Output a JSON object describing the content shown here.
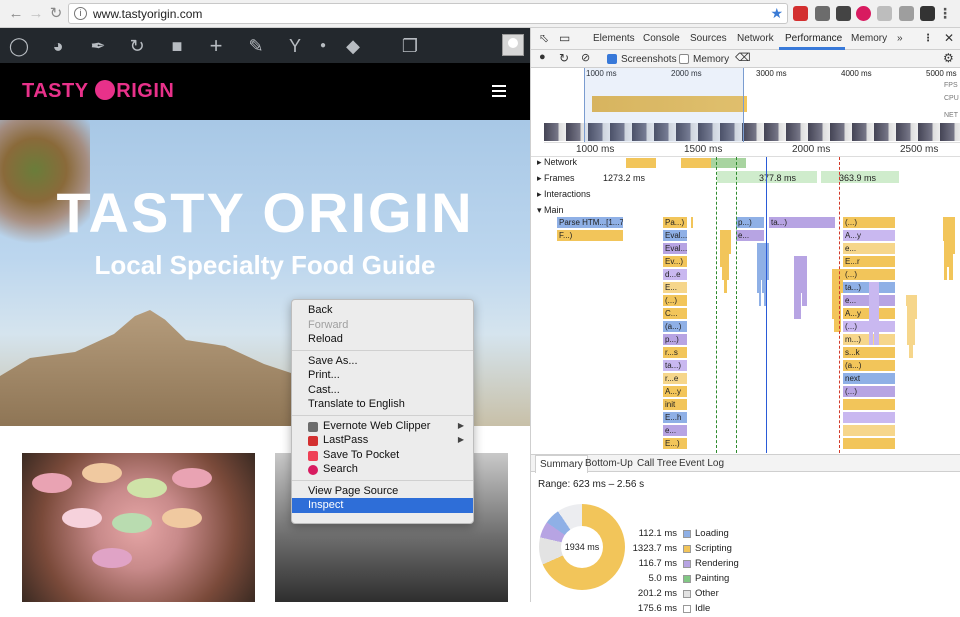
{
  "browser": {
    "url": "www.tastyorigin.com",
    "back_icon": "arrow-left",
    "forward_icon": "arrow-right",
    "reload_icon": "reload"
  },
  "wp_admin_bar": {
    "icons": [
      "wordpress-logo",
      "dashboard",
      "customize-brush",
      "updates",
      "comments",
      "new-plus",
      "edit-pencil",
      "yoast-seo",
      "dot",
      "layers"
    ]
  },
  "site": {
    "logo_part1": "TASTY",
    "logo_part2": "RIGIN",
    "hero_title": "TASTY ORIGIN",
    "hero_subtitle": "Local Specialty Food Guide",
    "accent_color": "#e8318a"
  },
  "context_menu": {
    "back": "Back",
    "forward": "Forward",
    "reload": "Reload",
    "save_as": "Save As...",
    "print": "Print...",
    "cast": "Cast...",
    "translate": "Translate to English",
    "evernote": "Evernote Web Clipper",
    "lastpass": "LastPass",
    "pocket": "Save To Pocket",
    "search": "Search",
    "view_source": "View Page Source",
    "inspect": "Inspect"
  },
  "devtools": {
    "tabs": [
      "Elements",
      "Console",
      "Sources",
      "Network",
      "Performance",
      "Memory",
      "»"
    ],
    "active_tab": "Performance",
    "screenshots_label": "Screenshots",
    "memory_label": "Memory",
    "overview_ticks": [
      "1000 ms",
      "2000 ms",
      "3000 ms",
      "4000 ms",
      "5000 ms"
    ],
    "overview_labels": [
      "FPS",
      "CPU",
      "NET"
    ],
    "ruler_ticks": [
      "1000 ms",
      "1500 ms",
      "2000 ms",
      "2500 ms"
    ],
    "tracks": {
      "network": "Network",
      "frames": "Frames",
      "interactions": "Interactions",
      "main": "Main"
    },
    "frame_times": [
      "1273.2 ms",
      "377.8 ms",
      "363.9 ms"
    ],
    "flame_labels": [
      "Parse HTM...[1...77])",
      "F...)",
      "Pa...)",
      "Eval...s:1)",
      "Eval...s:1)",
      "Ev...)",
      "d...e",
      "E...",
      "(...)",
      "C...",
      "(a...)",
      "p...)",
      "r...s",
      "ta...)",
      "r...e",
      "A...y",
      "init",
      "E...h",
      "e...",
      "E...)",
      "p...)",
      "e...",
      "ta...)",
      "(...)",
      "A...y",
      "e...",
      "E...r",
      "(...)",
      "ta...)",
      "e...",
      "A...y",
      "(...)",
      "m...)",
      "s...k",
      "(a...)",
      "next",
      "(...)"
    ],
    "summary_tabs": [
      "Summary",
      "Bottom-Up",
      "Call Tree",
      "Event Log"
    ],
    "range": "Range: 623 ms – 2.56 s",
    "donut_total": "1934 ms",
    "summary": [
      {
        "value": "112.1 ms",
        "name": "Loading",
        "color": "#8fb0e6"
      },
      {
        "value": "1323.7 ms",
        "name": "Scripting",
        "color": "#f2c55a"
      },
      {
        "value": "116.7 ms",
        "name": "Rendering",
        "color": "#b7a4e3"
      },
      {
        "value": "5.0 ms",
        "name": "Painting",
        "color": "#81c784"
      },
      {
        "value": "201.2 ms",
        "name": "Other",
        "color": "#e3e3e3"
      },
      {
        "value": "175.6 ms",
        "name": "Idle",
        "color": "#ffffff"
      }
    ]
  }
}
